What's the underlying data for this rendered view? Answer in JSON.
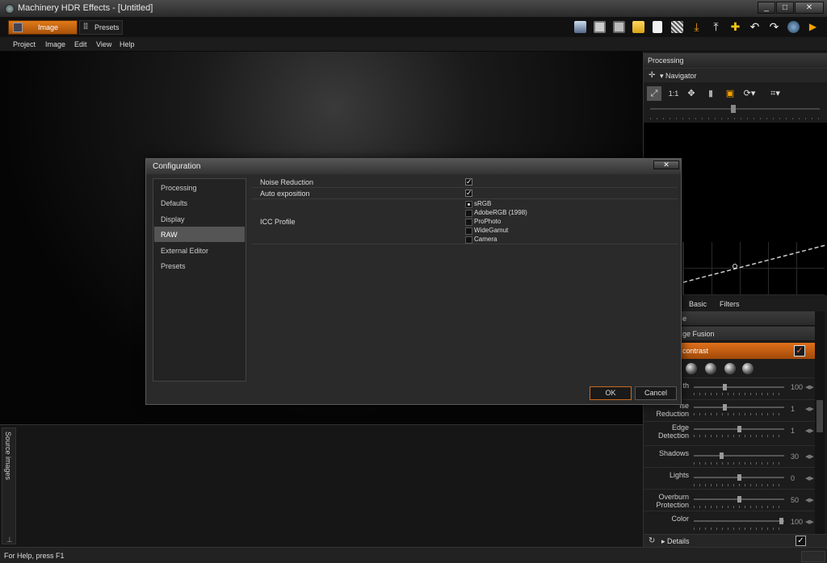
{
  "window": {
    "title": "Machinery HDR Effects - [Untitled]",
    "controls": [
      "_",
      "□",
      "✕"
    ]
  },
  "modes": {
    "image": "Image",
    "presets": "Presets"
  },
  "menu": [
    "Project",
    "Image",
    "Edit",
    "View",
    "Help"
  ],
  "toolbar_icons": [
    "picture-icon",
    "save-icon",
    "save-as-icon",
    "open-folder-icon",
    "new-file-icon",
    "pattern-icon",
    "download-icon",
    "upload-icon",
    "add-icon",
    "undo-icon",
    "redo-icon",
    "refresh-icon",
    "play-icon"
  ],
  "processing": {
    "title": "Processing",
    "navigator_label": "Navigator",
    "zoom_label": "1:1",
    "tabs": [
      "Basic",
      "Filters"
    ],
    "section_fusion": "ge Fusion",
    "section_top": "e",
    "section_active": "contrast",
    "params": [
      {
        "name": "th",
        "value": "100"
      },
      {
        "name": "ise\nReduction",
        "value": "1"
      },
      {
        "name": "Edge\nDetection",
        "value": "1"
      },
      {
        "name": "Shadows",
        "value": "30"
      },
      {
        "name": "Lights",
        "value": "0"
      },
      {
        "name": "Overburn\nProtection",
        "value": "50"
      },
      {
        "name": "Color",
        "value": "100"
      }
    ],
    "details_label": "Details"
  },
  "source_images_label": "Source images",
  "status": {
    "help": "For Help, press F1"
  },
  "dialog": {
    "title": "Configuration",
    "close": "✕",
    "categories": [
      "Processing",
      "Defaults",
      "Display",
      "RAW",
      "External Editor",
      "Presets"
    ],
    "selected_category": "RAW",
    "rows": {
      "noise_reduction": "Noise Reduction",
      "auto_exposition": "Auto exposition",
      "icc_profile": "ICC Profile"
    },
    "icc_options": [
      "sRGB",
      "AdobeRGB (1998)",
      "ProPhoto",
      "WideGamut",
      "Camera"
    ],
    "icc_selected": "sRGB",
    "ok": "OK",
    "cancel": "Cancel"
  },
  "colors": {
    "accent": "#e07a1a",
    "background": "#1a1a1a"
  }
}
